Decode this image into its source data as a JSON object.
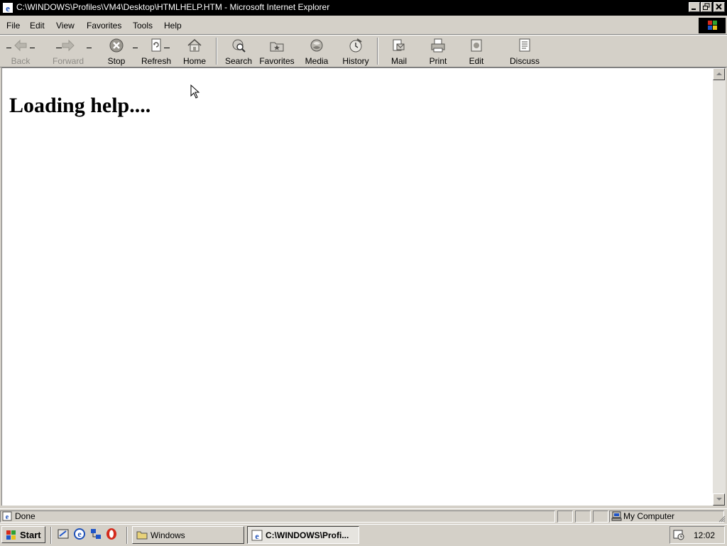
{
  "window": {
    "title": "C:\\WINDOWS\\Profiles\\VM4\\Desktop\\HTMLHELP.HTM - Microsoft Internet Explorer"
  },
  "menu": {
    "items": [
      {
        "label": "File"
      },
      {
        "label": "Edit"
      },
      {
        "label": "View"
      },
      {
        "label": "Favorites"
      },
      {
        "label": "Tools"
      },
      {
        "label": "Help"
      }
    ]
  },
  "toolbar": {
    "back": "Back",
    "forward": "Forward",
    "stop": "Stop",
    "refresh": "Refresh",
    "home": "Home",
    "search": "Search",
    "favorites": "Favorites",
    "media": "Media",
    "history": "History",
    "mail": "Mail",
    "print": "Print",
    "edit": "Edit",
    "discuss": "Discuss"
  },
  "page": {
    "heading": "Loading help...."
  },
  "status": {
    "text": "Done",
    "zone": "My Computer"
  },
  "taskbar": {
    "start": "Start",
    "tasks": [
      {
        "label": "Windows"
      },
      {
        "label": "C:\\WINDOWS\\Profi..."
      }
    ],
    "clock": "12:02"
  },
  "colors": {
    "chrome": "#d4d0c8",
    "titlebar": "#000000",
    "content": "#ffffff"
  }
}
